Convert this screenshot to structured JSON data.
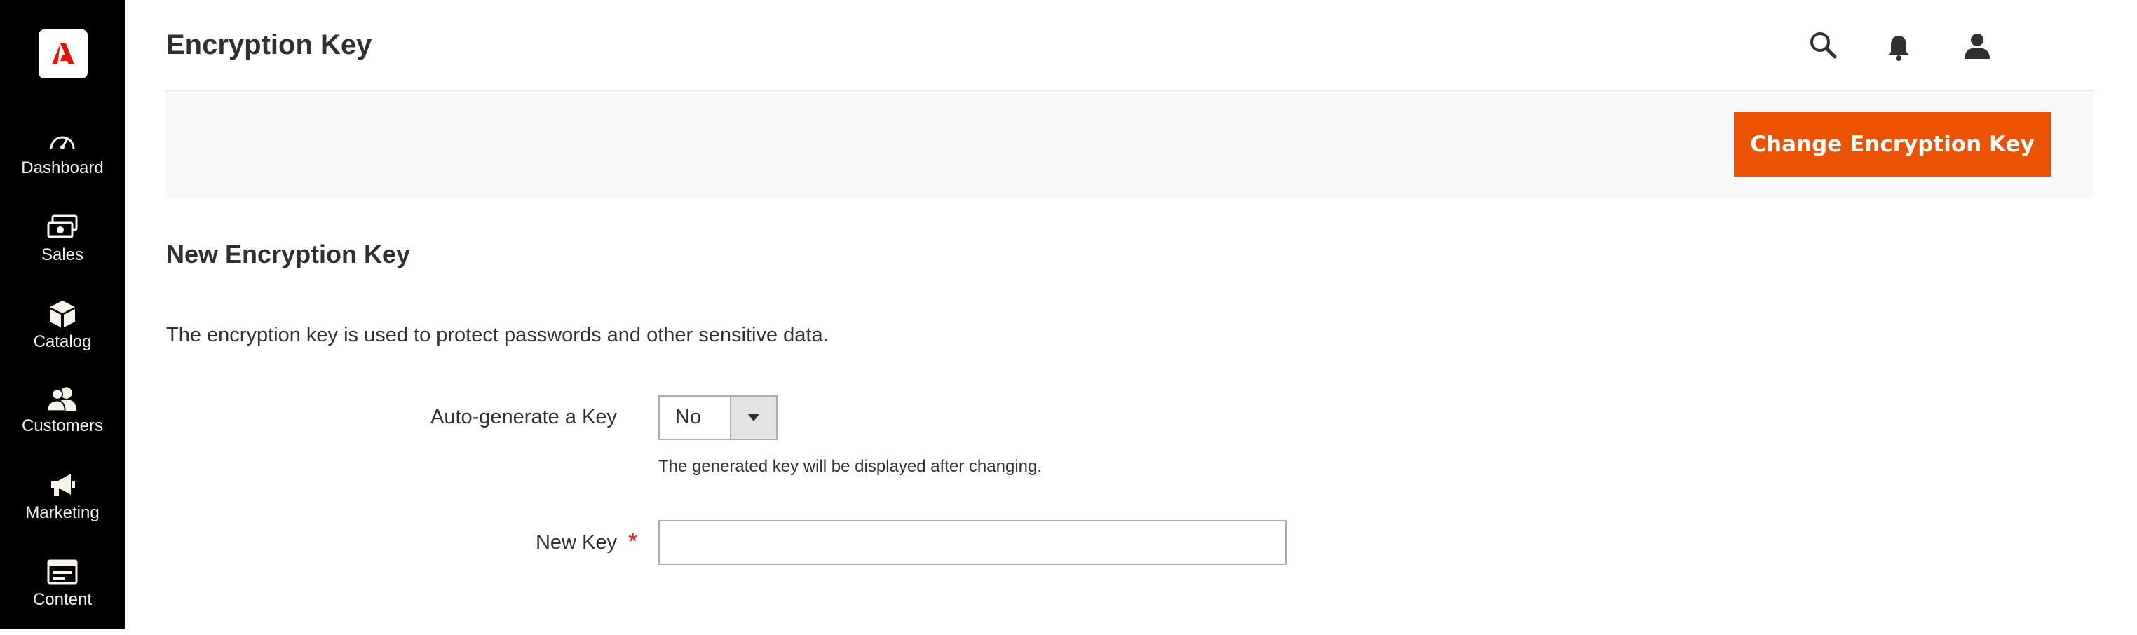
{
  "sidebar": {
    "logo_icon": "adobe-logo-icon",
    "items": [
      {
        "label": "Dashboard",
        "icon": "dashboard-icon"
      },
      {
        "label": "Sales",
        "icon": "sales-icon"
      },
      {
        "label": "Catalog",
        "icon": "catalog-icon"
      },
      {
        "label": "Customers",
        "icon": "customers-icon"
      },
      {
        "label": "Marketing",
        "icon": "marketing-icon"
      },
      {
        "label": "Content",
        "icon": "content-icon"
      }
    ]
  },
  "header": {
    "title": "Encryption Key",
    "icons": [
      "search-icon",
      "notifications-icon",
      "user-icon",
      "chevron-down-icon"
    ]
  },
  "action_bar": {
    "primary_button_label": "Change Encryption Key"
  },
  "section": {
    "title": "New Encryption Key",
    "description": "The encryption key is used to protect passwords and other sensitive data.",
    "auto_generate": {
      "label": "Auto-generate a Key",
      "selected": "No",
      "note": "The generated key will be displayed after changing."
    },
    "new_key": {
      "label": "New Key",
      "required_marker": "*",
      "value": ""
    }
  },
  "colors": {
    "sidebar_bg": "#000000",
    "accent": "#eb5202",
    "required": "#e22626",
    "action_bar_bg": "#f8f8f8"
  }
}
